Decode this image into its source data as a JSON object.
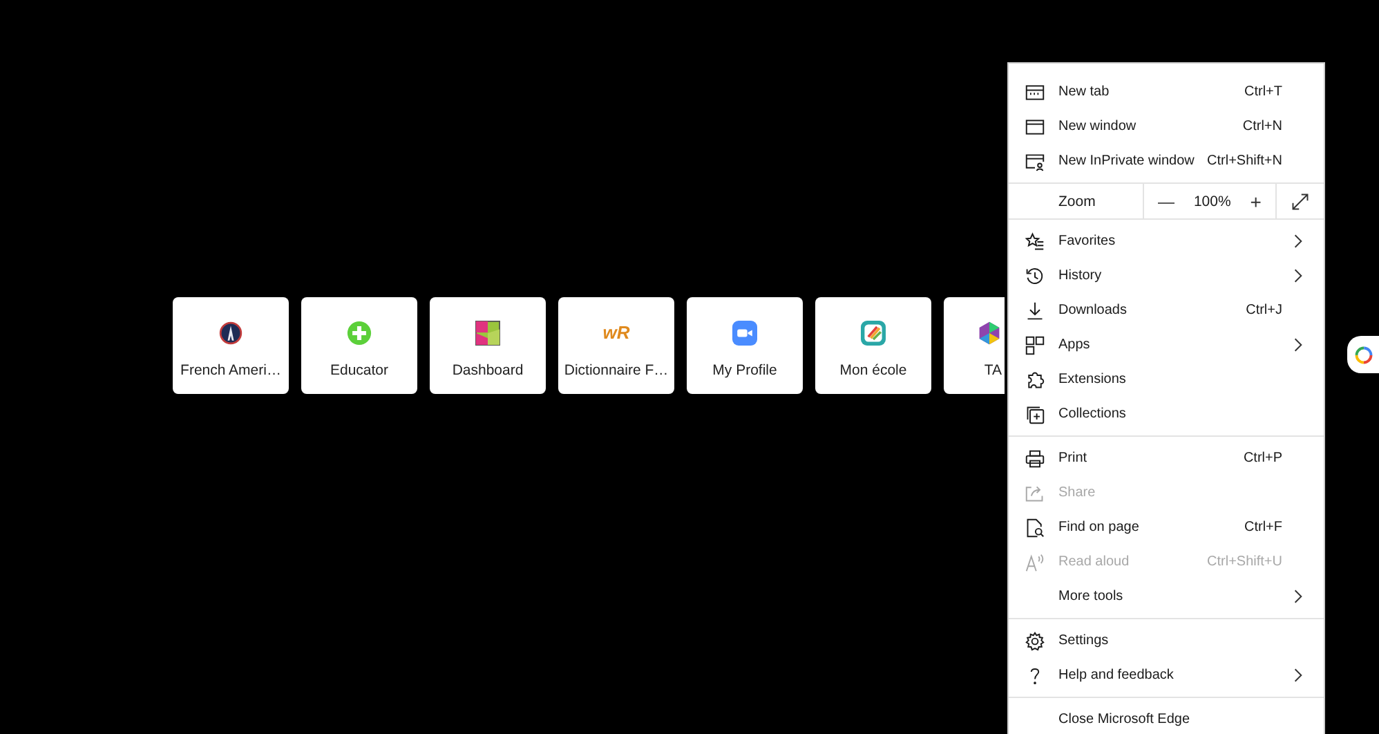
{
  "tiles": [
    {
      "label": "French Ameri…",
      "partial": false
    },
    {
      "label": "Educator",
      "partial": false
    },
    {
      "label": "Dashboard",
      "partial": false
    },
    {
      "label": "Dictionnaire F…",
      "logo_text": "wR",
      "partial": false
    },
    {
      "label": "My Profile",
      "partial": false
    },
    {
      "label": "Mon école",
      "partial": false
    },
    {
      "label": "TA",
      "partial": true
    }
  ],
  "menu": {
    "sections": [
      {
        "items": [
          {
            "kind": "item",
            "label": "New tab",
            "shortcut": "Ctrl+T",
            "submenu": false,
            "disabled": false
          },
          {
            "kind": "item",
            "label": "New window",
            "shortcut": "Ctrl+N",
            "submenu": false,
            "disabled": false
          },
          {
            "kind": "item",
            "label": "New InPrivate window",
            "shortcut": "Ctrl+Shift+N",
            "submenu": false,
            "disabled": false
          }
        ]
      },
      {
        "items": [
          {
            "kind": "zoom",
            "label": "Zoom",
            "minus": "—",
            "value": "100%",
            "plus": "+"
          }
        ]
      },
      {
        "items": [
          {
            "kind": "item",
            "label": "Favorites",
            "submenu": true,
            "disabled": false
          },
          {
            "kind": "item",
            "label": "History",
            "submenu": true,
            "disabled": false
          },
          {
            "kind": "item",
            "label": "Downloads",
            "shortcut": "Ctrl+J",
            "submenu": false,
            "disabled": false
          },
          {
            "kind": "item",
            "label": "Apps",
            "submenu": true,
            "disabled": false
          },
          {
            "kind": "item",
            "label": "Extensions",
            "submenu": false,
            "disabled": false
          },
          {
            "kind": "item",
            "label": "Collections",
            "submenu": false,
            "disabled": false
          }
        ]
      },
      {
        "items": [
          {
            "kind": "item",
            "label": "Print",
            "shortcut": "Ctrl+P",
            "submenu": false,
            "disabled": false
          },
          {
            "kind": "item",
            "label": "Share",
            "submenu": false,
            "disabled": true
          },
          {
            "kind": "item",
            "label": "Find on page",
            "shortcut": "Ctrl+F",
            "submenu": false,
            "disabled": false
          },
          {
            "kind": "item",
            "label": "Read aloud",
            "shortcut": "Ctrl+Shift+U",
            "submenu": false,
            "disabled": true
          },
          {
            "kind": "item",
            "label": "More tools",
            "submenu": true,
            "disabled": false
          }
        ]
      },
      {
        "items": [
          {
            "kind": "item",
            "label": "Settings",
            "submenu": false,
            "disabled": false
          },
          {
            "kind": "item",
            "label": "Help and feedback",
            "submenu": true,
            "disabled": false
          }
        ]
      },
      {
        "items": [
          {
            "kind": "item",
            "label": "Close Microsoft Edge",
            "submenu": false,
            "disabled": false
          }
        ]
      }
    ]
  }
}
